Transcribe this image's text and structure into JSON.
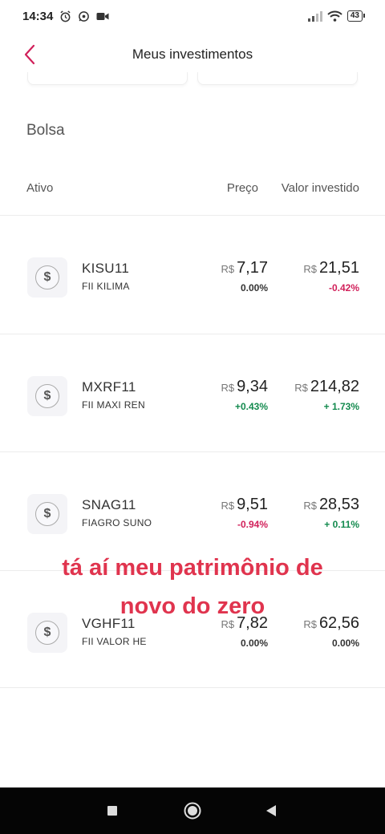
{
  "status_bar": {
    "time": "14:34",
    "battery": "43"
  },
  "header": {
    "title": "Meus investimentos"
  },
  "section": {
    "title": "Bolsa"
  },
  "columns": {
    "ativo": "Ativo",
    "preco": "Preço",
    "valor": "Valor investido"
  },
  "assets": [
    {
      "ticker": "KISU11",
      "name": "FII KILIMA",
      "currency": "R$",
      "price": "7,17",
      "price_change": "0.00%",
      "invested": "21,51",
      "invested_change": "-0.42%"
    },
    {
      "ticker": "MXRF11",
      "name": "FII MAXI REN",
      "currency": "R$",
      "price": "9,34",
      "price_change": "+0.43%",
      "invested": "214,82",
      "invested_change": "+ 1.73%"
    },
    {
      "ticker": "SNAG11",
      "name": "FIAGRO SUNO",
      "currency": "R$",
      "price": "9,51",
      "price_change": "-0.94%",
      "invested": "28,53",
      "invested_change": "+ 0.11%"
    },
    {
      "ticker": "VGHF11",
      "name": "FII VALOR HE",
      "currency": "R$",
      "price": "7,82",
      "price_change": "0.00%",
      "invested": "62,56",
      "invested_change": "0.00%"
    }
  ],
  "icons": {
    "asset": "dollar-coin-icon",
    "back": "chevron-left-icon"
  },
  "colors": {
    "accent": "#d1205a",
    "positive": "#138a4e",
    "negative": "#d1205a",
    "caption": "#e0344e"
  },
  "caption": {
    "line1": "tá aí meu patrimônio de",
    "line2": "novo do zero"
  }
}
